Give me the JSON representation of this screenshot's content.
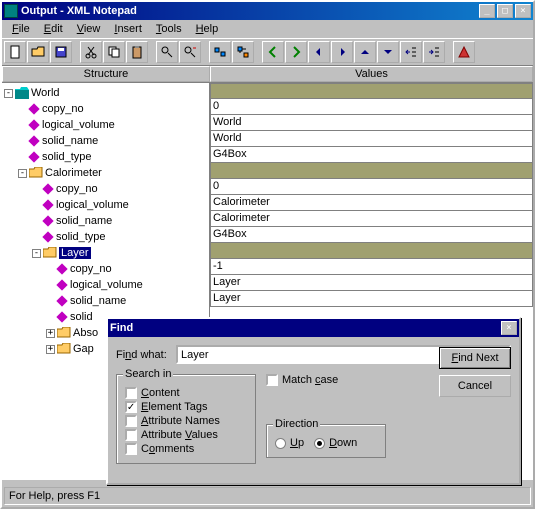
{
  "titlebar": {
    "title": "Output - XML Notepad"
  },
  "menu": {
    "file": "File",
    "edit": "Edit",
    "view": "View",
    "insert": "Insert",
    "tools": "Tools",
    "help": "Help"
  },
  "headers": {
    "structure": "Structure",
    "values": "Values"
  },
  "tree": {
    "world": "World",
    "copy_no": "copy_no",
    "logical_volume": "logical_volume",
    "solid_name": "solid_name",
    "solid_type": "solid_type",
    "calorimeter": "Calorimeter",
    "layer": "Layer",
    "absorber": "Abso",
    "gap": "Gap"
  },
  "values": {
    "r0": "",
    "r1": "0",
    "r2": "World",
    "r3": "World",
    "r4": "G4Box",
    "r5": "",
    "r6": "0",
    "r7": "Calorimeter",
    "r8": "Calorimeter",
    "r9": "G4Box",
    "r10": "",
    "r11": "-1",
    "r12": "Layer",
    "r13": "Layer"
  },
  "status": "For Help, press F1",
  "find": {
    "title": "Find",
    "find_what_label": "Find what:",
    "find_what_value": "Layer",
    "search_in_label": "Search in",
    "content": "Content",
    "element_tags": "Element Tags",
    "attribute_names": "Attribute Names",
    "attribute_values": "Attribute Values",
    "comments": "Comments",
    "match_case": "Match case",
    "direction_label": "Direction",
    "up": "Up",
    "down": "Down",
    "find_next": "Find Next",
    "cancel": "Cancel",
    "checked": {
      "content": false,
      "element_tags": true,
      "attribute_names": false,
      "attribute_values": false,
      "comments": false,
      "match_case": false
    },
    "direction": "down"
  },
  "icons": {
    "new": "new",
    "open": "open",
    "save": "save",
    "cut": "cut",
    "copy": "copy",
    "paste": "paste",
    "find": "find",
    "findnext": "findnext",
    "duplicate": "duplicate",
    "split": "split",
    "left": "left",
    "right": "right",
    "prev": "prev",
    "next": "next",
    "up": "up",
    "down": "down",
    "outdent": "outdent",
    "indent": "indent",
    "help": "help"
  }
}
